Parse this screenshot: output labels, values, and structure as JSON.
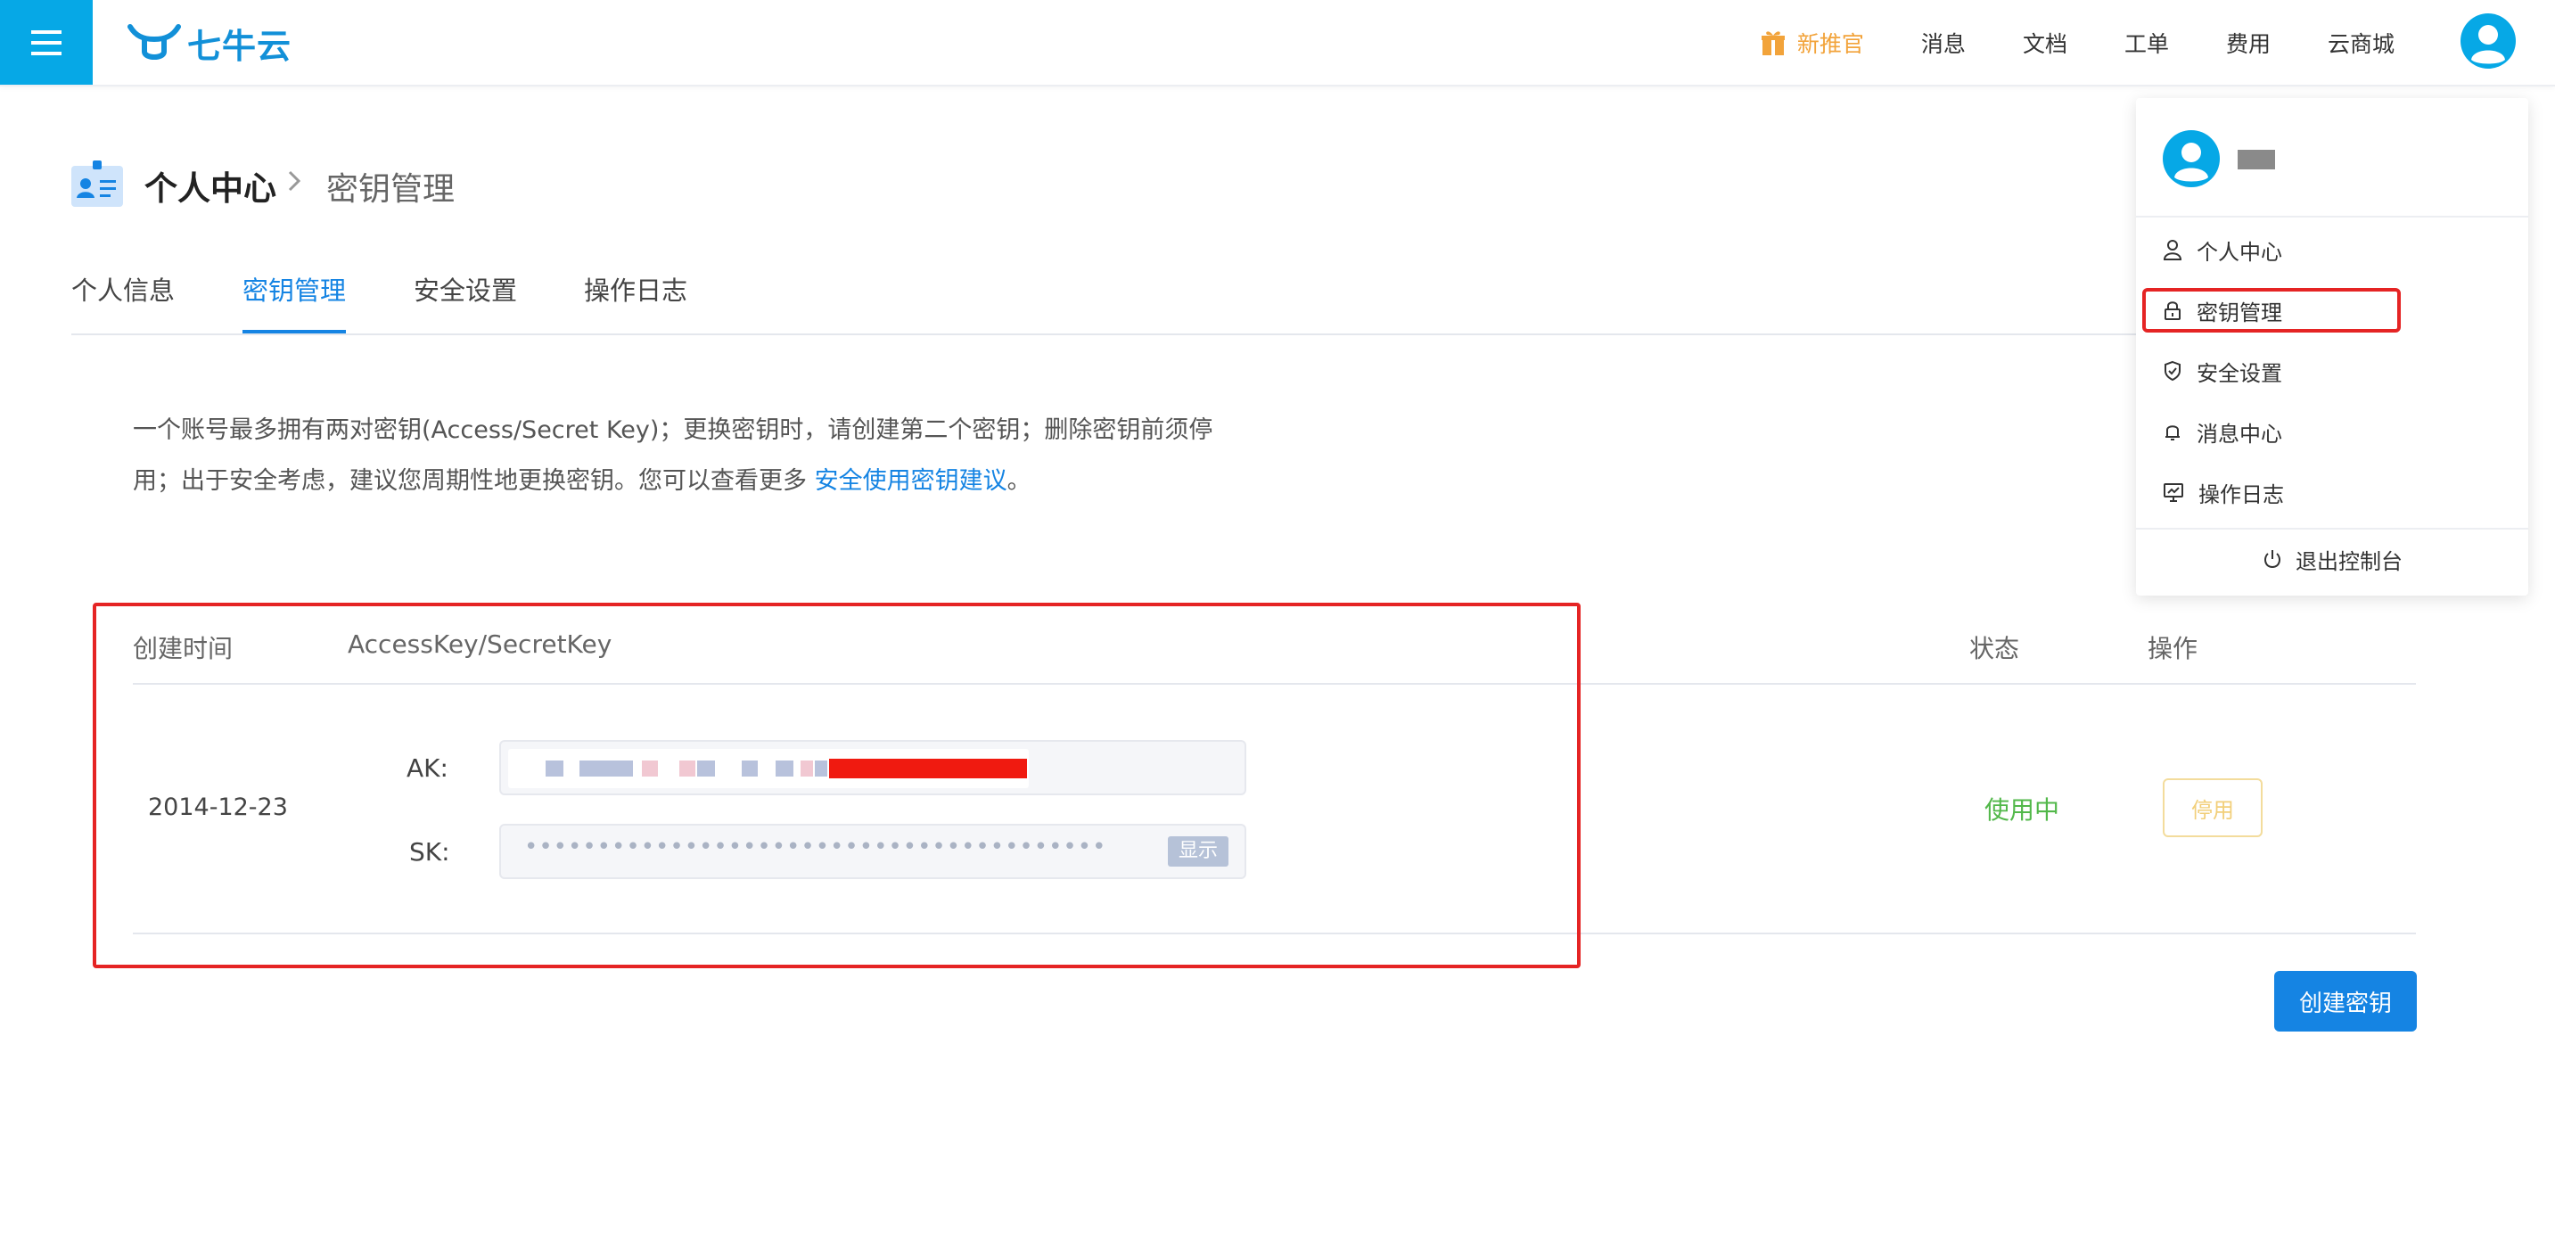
{
  "brand": {
    "name": "七牛云",
    "accent": "#06a8e6",
    "link": "#1584e3"
  },
  "topbar": {
    "promo": "新推官",
    "nav": [
      "消息",
      "文档",
      "工单",
      "费用",
      "云商城"
    ]
  },
  "breadcrumb": {
    "root": "个人中心",
    "current": "密钥管理"
  },
  "tabs": [
    "个人信息",
    "密钥管理",
    "安全设置",
    "操作日志"
  ],
  "active_tab": "密钥管理",
  "description": {
    "text": "一个账号最多拥有两对密钥(Access/Secret Key)；更换密钥时，请创建第二个密钥；删除密钥前须停用；出于安全考虑，建议您周期性地更换密钥。您可以查看更多",
    "link": "安全使用密钥建议",
    "end": "。"
  },
  "table": {
    "headers": {
      "created": "创建时间",
      "keys": "AccessKey/SecretKey",
      "status": "状态",
      "actions": "操作"
    },
    "rows": [
      {
        "created": "2014-12-23",
        "ak_label": "AK:",
        "sk_label": "SK:",
        "sk_masked": "••••••••••••••••••••••••••••••••••••••••",
        "show_label": "显示",
        "status": "使用中",
        "status_color": "#52b84a",
        "action": "停用"
      }
    ]
  },
  "create_button": "创建密钥",
  "user_menu": {
    "items": [
      {
        "label": "个人中心",
        "icon": "user-icon"
      },
      {
        "label": "密钥管理",
        "icon": "lock-icon"
      },
      {
        "label": "安全设置",
        "icon": "shield-icon"
      },
      {
        "label": "消息中心",
        "icon": "bell-icon"
      },
      {
        "label": "操作日志",
        "icon": "monitor-chart-icon"
      }
    ],
    "logout": "退出控制台"
  }
}
